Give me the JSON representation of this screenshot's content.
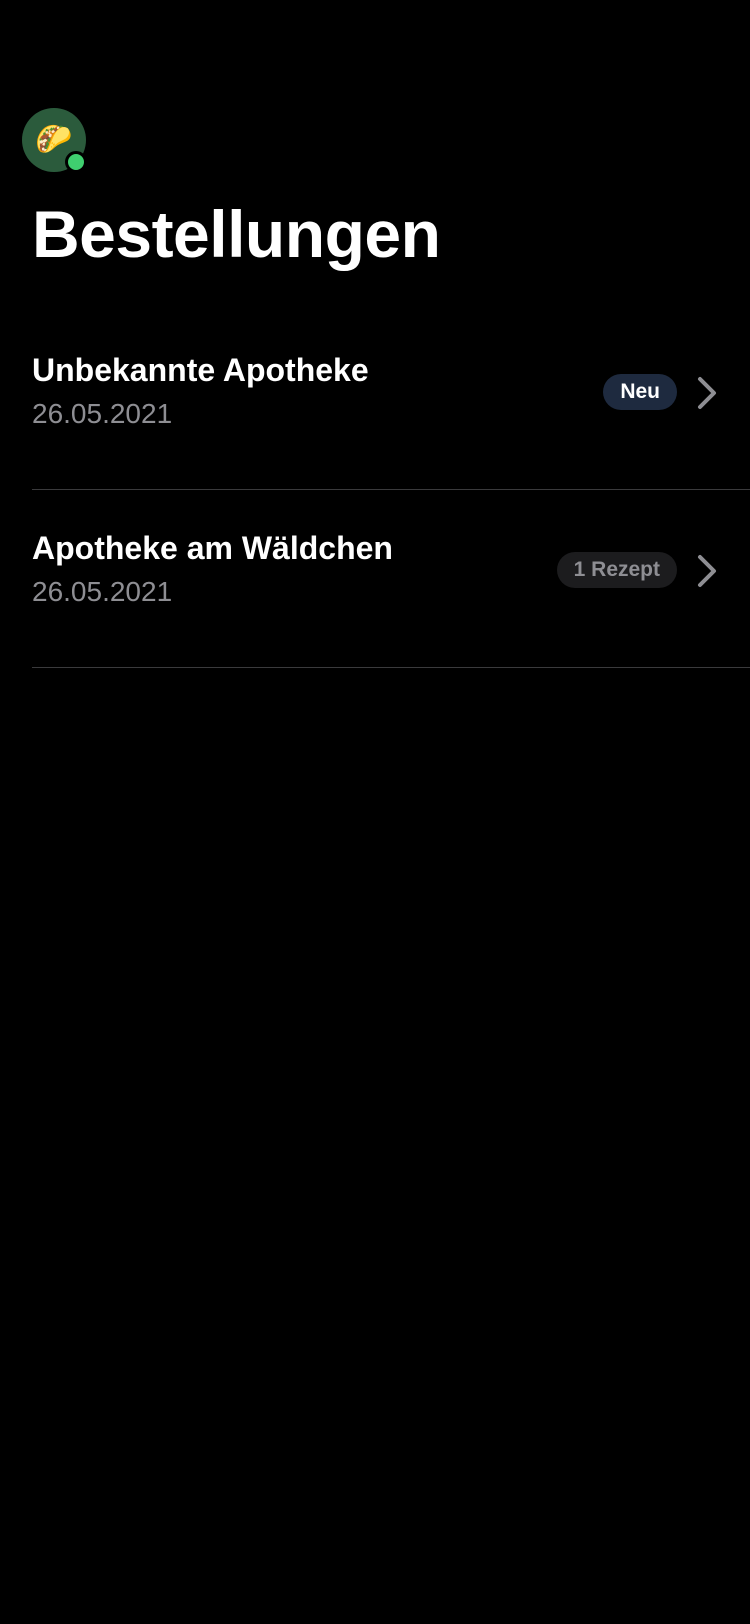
{
  "header": {
    "avatar_emoji": "🌮",
    "title": "Bestellungen"
  },
  "orders": [
    {
      "name": "Unbekannte Apotheke",
      "date": "26.05.2021",
      "badge": "Neu",
      "badge_style": "new"
    },
    {
      "name": "Apotheke am Wäldchen",
      "date": "26.05.2021",
      "badge": "1 Rezept",
      "badge_style": "neutral"
    }
  ],
  "icons": {
    "row_chevron": "chevron-right-icon",
    "online_status": "status-dot-icon"
  },
  "colors": {
    "background": "#000000",
    "avatar_bg": "#2b5b3c",
    "status_online": "#3fcf6f",
    "badge_new_bg": "#1e2a3f",
    "badge_neutral_bg": "#1c1c1e",
    "secondary_text": "#8e8e93",
    "chevron": "#8e8e93"
  }
}
